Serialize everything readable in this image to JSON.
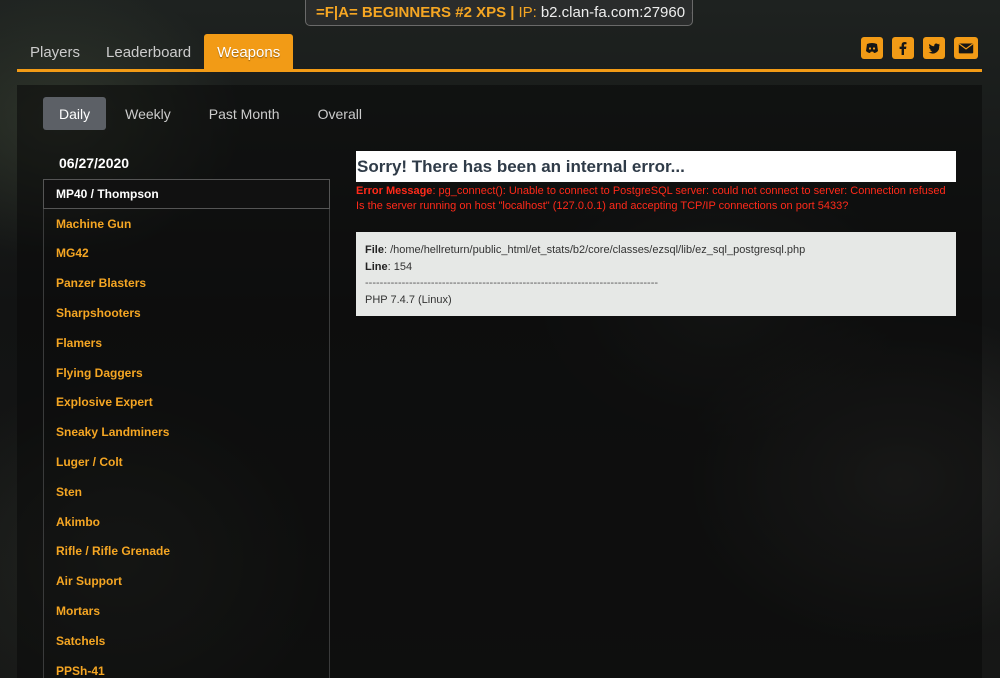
{
  "server": {
    "name": "=F|A= BEGINNERS #2 XPS |",
    "ip_label": "IP:",
    "ip_value": "b2.clan-fa.com:27960"
  },
  "nav": {
    "tabs": [
      {
        "label": "Players"
      },
      {
        "label": "Leaderboard"
      },
      {
        "label": "Weapons"
      }
    ],
    "active": "Weapons"
  },
  "social": [
    "discord-icon",
    "facebook-icon",
    "twitter-icon",
    "email-icon"
  ],
  "period_tabs": [
    {
      "label": "Daily"
    },
    {
      "label": "Weekly"
    },
    {
      "label": "Past Month"
    },
    {
      "label": "Overall"
    }
  ],
  "weapons": {
    "date": "06/27/2020",
    "items": [
      "MP40 / Thompson",
      "Machine Gun",
      "MG42",
      "Panzer Blasters",
      "Sharpshooters",
      "Flamers",
      "Flying Daggers",
      "Explosive Expert",
      "Sneaky Landminers",
      "Luger / Colt",
      "Sten",
      "Akimbo",
      "Rifle / Rifle Grenade",
      "Air Support",
      "Mortars",
      "Satchels",
      "PPSh-41"
    ]
  },
  "error": {
    "title": "Sorry! There has been an internal error...",
    "message_label": "Error Message",
    "message": ": pg_connect(): Unable to connect to PostgreSQL server: could not connect to server: Connection refused Is the server running on host \"localhost\" (127.0.0.1) and accepting TCP/IP connections on port 5433?",
    "file_label": "File",
    "file": ": /home/hellreturn/public_html/et_stats/b2/core/classes/ezsql/lib/ez_sql_postgresql.php",
    "line_label": "Line",
    "line": ": 154",
    "separator": "--------------------------------------------------------------------------------",
    "php": "PHP 7.4.7 (Linux)"
  },
  "colors": {
    "accent": "#f29b16",
    "error": "#ff2a1a"
  }
}
